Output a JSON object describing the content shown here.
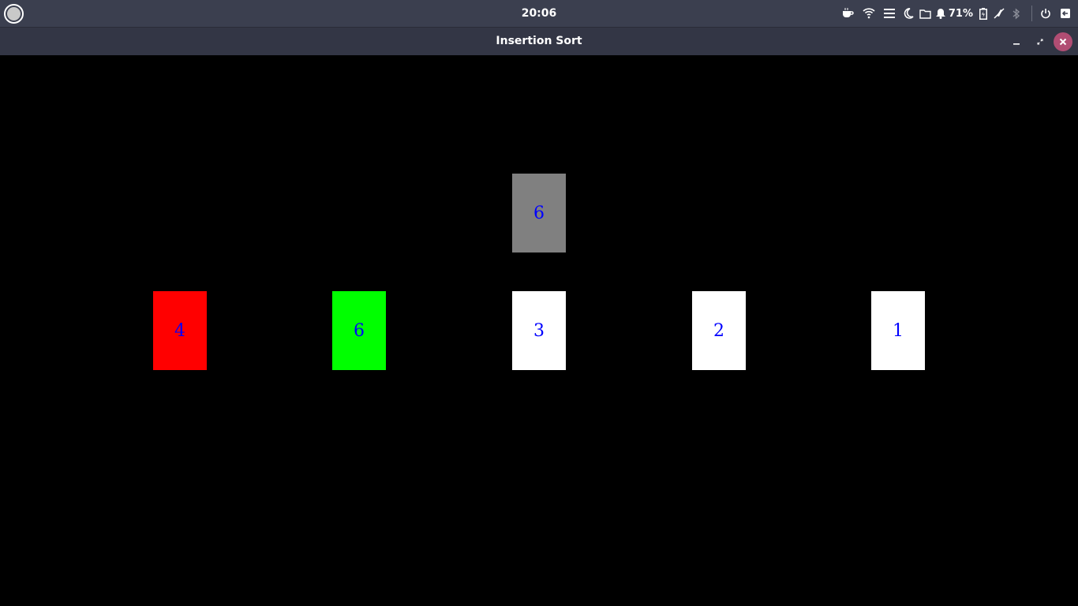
{
  "system_bar": {
    "time": "20:06",
    "battery_percent": "71%",
    "icons": [
      "activities-icon",
      "coffee-icon",
      "wifi-icon",
      "menu-icon",
      "night-mode-icon",
      "folder-icon",
      "bell-icon",
      "battery-icon",
      "no-notifications-icon",
      "bluetooth-icon",
      "power-icon",
      "logout-icon"
    ]
  },
  "window": {
    "title": "Insertion Sort",
    "buttons": [
      "minimize-icon",
      "restore-icon",
      "close-icon"
    ]
  },
  "sort": {
    "key_card": {
      "value": "6",
      "color": "#808080"
    },
    "cards": [
      {
        "value": "4",
        "color": "#ff0000"
      },
      {
        "value": "6",
        "color": "#00ff00"
      },
      {
        "value": "3",
        "color": "#ffffff"
      },
      {
        "value": "2",
        "color": "#ffffff"
      },
      {
        "value": "1",
        "color": "#ffffff"
      }
    ],
    "text_color": "#0000ff"
  }
}
